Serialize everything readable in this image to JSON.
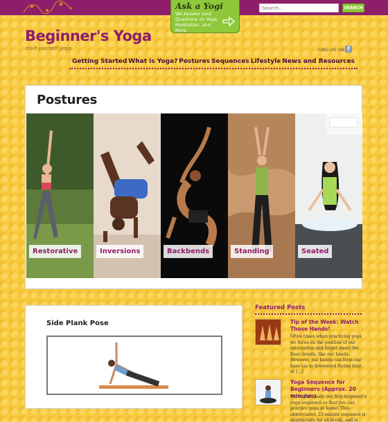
{
  "header": {
    "ask_yogi": {
      "title": "Ask a Yogi",
      "description": "We Answer your Questions on Yoga, Meditation, and More"
    },
    "search": {
      "placeholder": "Search...",
      "button_label": "SEARCH"
    },
    "logo": "Beginner's Yoga",
    "tagline": "do-it-yourself yoga",
    "find_us_label": "FIND US ON",
    "colors": {
      "brand": "#8e1e6a",
      "accent": "#8fc83a",
      "background": "#f7c93e"
    }
  },
  "nav": {
    "items": [
      {
        "label": "Getting Started"
      },
      {
        "label": "What is Yoga?"
      },
      {
        "label": "Postures"
      },
      {
        "label": "Sequences"
      },
      {
        "label": "Lifestyle"
      },
      {
        "label": "News and Resources"
      }
    ]
  },
  "postures": {
    "title": "Postures",
    "categories": [
      {
        "label": "Restorative"
      },
      {
        "label": "Inversions"
      },
      {
        "label": "Backbends"
      },
      {
        "label": "Standing"
      },
      {
        "label": "Seated"
      }
    ]
  },
  "feature": {
    "title": "Side Plank Pose"
  },
  "featured_posts": {
    "heading": "Featured Posts",
    "posts": [
      {
        "title": "Tip of the Week: Watch Those Hands!",
        "excerpt": "Often times when practicing yoga we focus on the position of our extremities and forget about the finer details, like our hands.  However, our hands can form our base (as in downward facing dog), or [...]"
      },
      {
        "title": "Yoga Sequence for Beginners (Approx. 20 minutes)",
        "excerpt": "We've just made our first beginner's yoga sequence so that you can practice yoga at home! This abbreviated, 23-minute sequence is appropriate for all levels, and is"
      }
    ]
  }
}
